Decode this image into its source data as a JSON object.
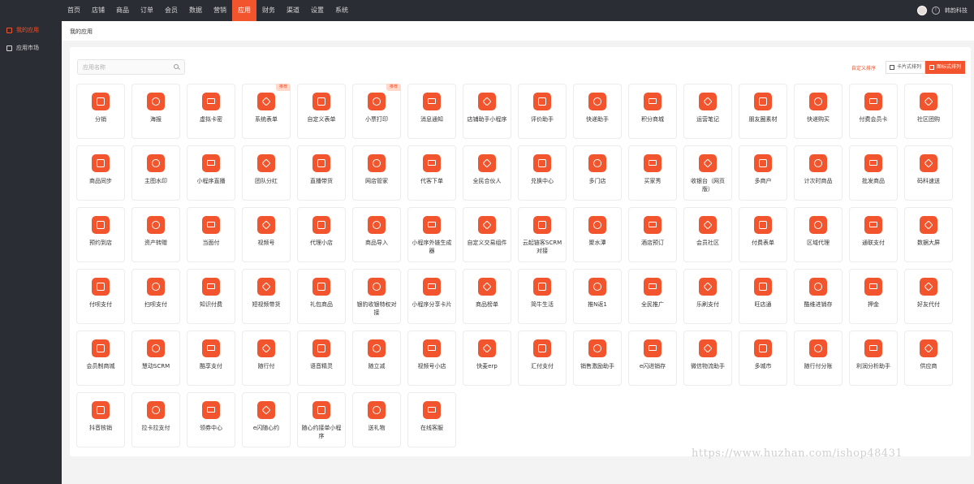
{
  "colors": {
    "accent": "#f2542d",
    "topbar": "#2a2d33",
    "page_bg": "#f3f3f4"
  },
  "topnav": {
    "items": [
      {
        "label": "首页",
        "active": false
      },
      {
        "label": "店铺",
        "active": false
      },
      {
        "label": "商品",
        "active": false
      },
      {
        "label": "订单",
        "active": false
      },
      {
        "label": "会员",
        "active": false
      },
      {
        "label": "数据",
        "active": false
      },
      {
        "label": "营销",
        "active": false
      },
      {
        "label": "应用",
        "active": true
      },
      {
        "label": "财务",
        "active": false
      },
      {
        "label": "渠道",
        "active": false
      },
      {
        "label": "设置",
        "active": false
      },
      {
        "label": "系统",
        "active": false
      }
    ],
    "user_name": "韩韵科技"
  },
  "sidebar": {
    "items": [
      {
        "label": "我的应用",
        "icon": "app-icon",
        "active": true
      },
      {
        "label": "应用市场",
        "icon": "market-icon",
        "active": false
      }
    ]
  },
  "breadcrumb": {
    "label": "我的应用"
  },
  "search": {
    "placeholder": "应用名称",
    "value": ""
  },
  "toolbar": {
    "sort_label": "自定义排序",
    "view_card_label": "卡片式排列",
    "view_icon_label": "图标式排列"
  },
  "apps": [
    {
      "label": "分销"
    },
    {
      "label": "海报"
    },
    {
      "label": "虚拟卡密"
    },
    {
      "label": "系统表单",
      "tag": "推荐"
    },
    {
      "label": "自定义表单"
    },
    {
      "label": "小票打印",
      "tag": "推荐"
    },
    {
      "label": "消息通知"
    },
    {
      "label": "店铺助手小程序"
    },
    {
      "label": "评价助手"
    },
    {
      "label": "快递助手"
    },
    {
      "label": "积分商城"
    },
    {
      "label": "运营笔记"
    },
    {
      "label": "朋友圈素材"
    },
    {
      "label": "快递购买"
    },
    {
      "label": "付费会员卡"
    },
    {
      "label": "社区团购"
    },
    {
      "label": "商品同步"
    },
    {
      "label": "主图水印"
    },
    {
      "label": "小程序直播"
    },
    {
      "label": "团队分红"
    },
    {
      "label": "直播带货"
    },
    {
      "label": "网店管家"
    },
    {
      "label": "代客下单"
    },
    {
      "label": "全民合伙人"
    },
    {
      "label": "兑换中心"
    },
    {
      "label": "多门店"
    },
    {
      "label": "买家秀"
    },
    {
      "label": "收银台（网页版）"
    },
    {
      "label": "多商户"
    },
    {
      "label": "计次时商品"
    },
    {
      "label": "批发商品"
    },
    {
      "label": "码科速送"
    },
    {
      "label": "预约到店"
    },
    {
      "label": "资产转赠"
    },
    {
      "label": "当面付"
    },
    {
      "label": "视频号"
    },
    {
      "label": "代理小店"
    },
    {
      "label": "商品导入"
    },
    {
      "label": "小程序外链生成器"
    },
    {
      "label": "自定义交易组件"
    },
    {
      "label": "云起链客SCRM对接"
    },
    {
      "label": "聚水潭"
    },
    {
      "label": "酒店预订"
    },
    {
      "label": "会员社区"
    },
    {
      "label": "付费表单"
    },
    {
      "label": "区域代理"
    },
    {
      "label": "通联支付"
    },
    {
      "label": "数据大屏"
    },
    {
      "label": "付呗支付"
    },
    {
      "label": "扫呗支付"
    },
    {
      "label": "知识付费"
    },
    {
      "label": "短视频带货"
    },
    {
      "label": "礼包商品"
    },
    {
      "label": "银豹收银特权对接"
    },
    {
      "label": "小程序分享卡片"
    },
    {
      "label": "商品榜单"
    },
    {
      "label": "简牛生活"
    },
    {
      "label": "推N返1"
    },
    {
      "label": "全民推广"
    },
    {
      "label": "乐刷支付"
    },
    {
      "label": "旺店通"
    },
    {
      "label": "酷维进销存"
    },
    {
      "label": "押金"
    },
    {
      "label": "好友代付"
    },
    {
      "label": "会员制商城"
    },
    {
      "label": "慧动SCRM"
    },
    {
      "label": "酷享支付"
    },
    {
      "label": "随行付"
    },
    {
      "label": "语音精灵"
    },
    {
      "label": "随立减"
    },
    {
      "label": "视频号小店"
    },
    {
      "label": "快麦erp"
    },
    {
      "label": "汇付支付"
    },
    {
      "label": "销售激励助手"
    },
    {
      "label": "e闪进销存"
    },
    {
      "label": "微信物流助手"
    },
    {
      "label": "多城市"
    },
    {
      "label": "随行付分账"
    },
    {
      "label": "利润分析助手"
    },
    {
      "label": "供应商"
    },
    {
      "label": "抖音核销"
    },
    {
      "label": "拉卡拉支付"
    },
    {
      "label": "领券中心"
    },
    {
      "label": "e闪随心约"
    },
    {
      "label": "随心约接单小程序"
    },
    {
      "label": "送礼物"
    },
    {
      "label": "在线客服"
    }
  ],
  "watermark": "https://www.huzhan.com/ishop48431"
}
